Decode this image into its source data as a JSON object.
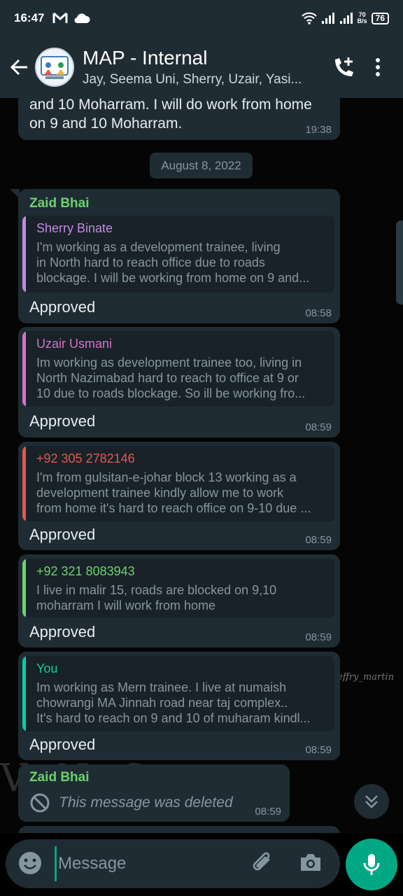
{
  "status": {
    "time": "16:47",
    "net_speed_value": "70",
    "net_speed_unit": "B/s",
    "battery": "76"
  },
  "header": {
    "title": "MAP - Internal",
    "members": "Jay, Seema Uni, Sherry, Uzair, Yasi..."
  },
  "previous_message": {
    "text_line1": "and 10 Moharram. I will do work from home",
    "text_line2": "on 9 and 10 Moharram.",
    "time": "19:38"
  },
  "date_chip": "August 8, 2022",
  "messages": [
    {
      "sender": "Zaid Bhai",
      "quote_name": "Sherry Binate",
      "quote_line1": "I'm working as a development trainee, living",
      "quote_line2": "in North hard to reach office due to roads",
      "quote_line3": "blockage. I will be working from home on 9 and...",
      "text": "Approved",
      "time": "08:58"
    },
    {
      "quote_name": "Uzair Usmani",
      "quote_line1": "Im working as development trainee too, living in",
      "quote_line2": "North Nazimabad hard to reach to office at 9 or",
      "quote_line3": "10 due to roads blockage. So ill be working fro...",
      "text": "Approved",
      "time": "08:59"
    },
    {
      "quote_name": "+92 305 2782146",
      "quote_line1": "I'm from gulsitan-e-johar block 13 working as a",
      "quote_line2": "development trainee kindly allow me to work",
      "quote_line3": "from home it's hard to reach office on 9-10 due ...",
      "text": "Approved",
      "time": "08:59"
    },
    {
      "quote_name": "+92 321 8083943",
      "quote_line1": "I live in malir 15, roads are blocked on 9,10",
      "quote_line2": "moharram I will work from home",
      "text": "Approved",
      "time": "08:59"
    },
    {
      "quote_name": "You",
      "quote_line1": "Im working as Mern trainee.  I live at numaish",
      "quote_line2": "chowrangi MA Jinnah road near taj complex..",
      "quote_line3": "It's hard to reach on 9 and 10 of muharam kindl...",
      "text": "Approved",
      "time": "08:59"
    }
  ],
  "deleted_message": {
    "sender": "Zaid Bhai",
    "text": "This message was deleted",
    "time": "08:59"
  },
  "wallpaper": {
    "letters": "V         N   G",
    "signature": "effry_martin"
  },
  "composer": {
    "placeholder": "Message"
  },
  "colors": {
    "bubble": "#1f2c34",
    "accent": "#00a884",
    "sender_zaid": "#53bdeb",
    "sherry": "#c38ae0",
    "uzair": "#d573c9",
    "phone1": "#e8564f",
    "phone2": "#6bd46b",
    "you": "#06cf9c"
  }
}
